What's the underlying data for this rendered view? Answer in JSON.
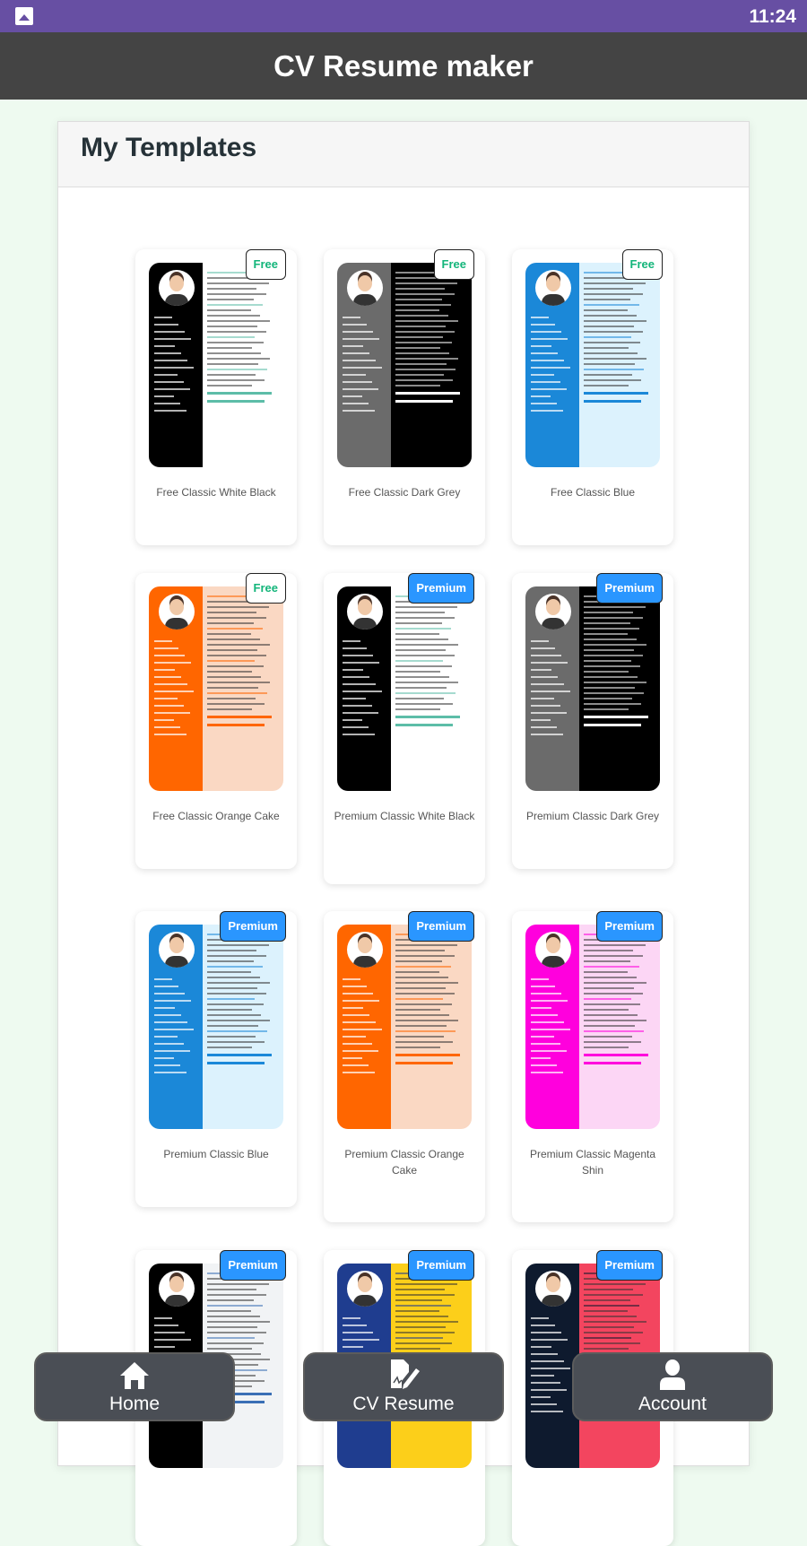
{
  "status_bar": {
    "time": "11:24"
  },
  "app_bar": {
    "title": "CV Resume maker"
  },
  "panel": {
    "title": "My Templates"
  },
  "templates": [
    {
      "name": "Free Classic White Black",
      "badge": "Free",
      "left": "#000000",
      "right": "#ffffff",
      "accent": "#5dbda8"
    },
    {
      "name": "Free Classic Dark Grey",
      "badge": "Free",
      "left": "#6b6b6b",
      "right": "#000000",
      "accent": "#ffffff"
    },
    {
      "name": "Free Classic Blue",
      "badge": "Free",
      "left": "#1b88d8",
      "right": "#dcf2fd",
      "accent": "#1b88d8"
    },
    {
      "name": "Free Classic Orange Cake",
      "badge": "Free",
      "left": "#ff6600",
      "right": "#fad8c3",
      "accent": "#ff6600"
    },
    {
      "name": "Premium Classic White Black",
      "badge": "Premium",
      "left": "#000000",
      "right": "#ffffff",
      "accent": "#5dbda8"
    },
    {
      "name": "Premium Classic Dark Grey",
      "badge": "Premium",
      "left": "#6b6b6b",
      "right": "#000000",
      "accent": "#ffffff"
    },
    {
      "name": "Premium Classic Blue",
      "badge": "Premium",
      "left": "#1b88d8",
      "right": "#dcf2fd",
      "accent": "#1b88d8"
    },
    {
      "name": "Premium Classic Orange Cake",
      "badge": "Premium",
      "left": "#ff6600",
      "right": "#fad8c3",
      "accent": "#ff6600"
    },
    {
      "name": "Premium Classic Magenta Shin",
      "badge": "Premium",
      "left": "#ff00dd",
      "right": "#fcd6f5",
      "accent": "#ff00dd"
    },
    {
      "name": "",
      "badge": "Premium",
      "left": "#000000",
      "right": "#f1f3f5",
      "accent": "#3a6fb5"
    },
    {
      "name": "",
      "badge": "Premium",
      "left": "#1f3d8f",
      "right": "#fccf1a",
      "accent": "#1f3d8f"
    },
    {
      "name": "",
      "badge": "Premium",
      "left": "#0e1a2e",
      "right": "#f3455f",
      "accent": "#0e1a2e"
    }
  ],
  "bottom_nav": [
    {
      "label": "Home",
      "icon": "home-icon"
    },
    {
      "label": "CV Resume",
      "icon": "document-edit-icon"
    },
    {
      "label": "Account",
      "icon": "person-icon"
    }
  ]
}
